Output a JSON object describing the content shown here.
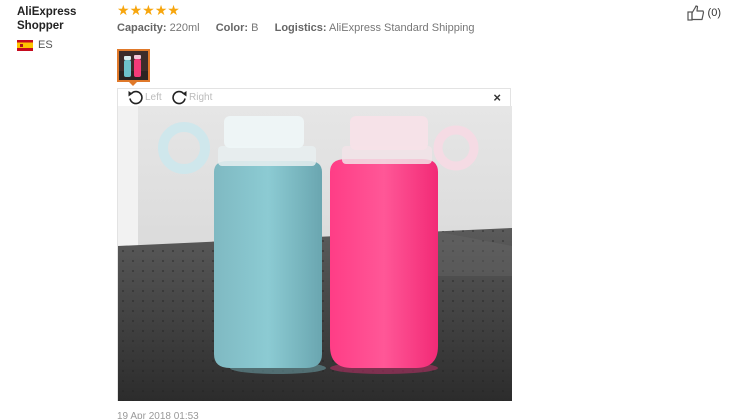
{
  "user": {
    "name": "AliExpress Shopper",
    "country_code": "ES"
  },
  "rating": {
    "stars": 5,
    "max": 5
  },
  "attributes": [
    {
      "label": "Capacity:",
      "value": "220ml"
    },
    {
      "label": "Color:",
      "value": "B"
    },
    {
      "label": "Logistics:",
      "value": "AliExpress Standard Shipping"
    }
  ],
  "helpful": {
    "count_label": "(0)"
  },
  "viewer": {
    "rotate_left": "Left",
    "rotate_right": "Right",
    "close_symbol": "×"
  },
  "review_date": "19 Apr 2018 01:53",
  "colors": {
    "star": "#f7a60e",
    "thumb_border": "#e0792a"
  },
  "icons": [
    "thumbs-up-icon",
    "rotate-left-icon",
    "rotate-right-icon",
    "close-icon",
    "flag-es-icon",
    "star-icon"
  ]
}
